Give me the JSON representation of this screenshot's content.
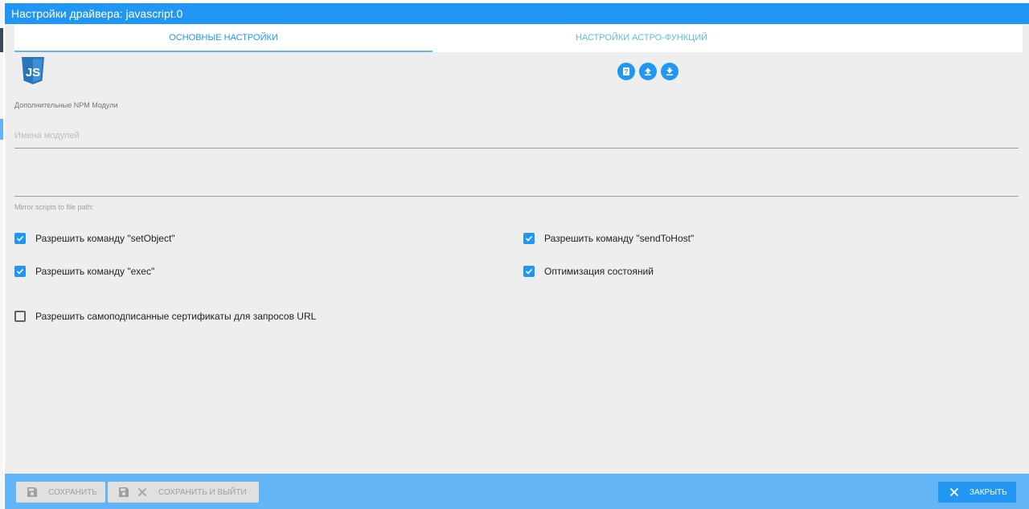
{
  "dialog": {
    "title": "Настройки драйвера: javascript.0"
  },
  "tabs": [
    {
      "label": "ОСНОВНЫЕ НАСТРОЙКИ",
      "active": true
    },
    {
      "label": "НАСТРОЙКИ АСТРО-ФУНКЦИЙ",
      "active": false
    }
  ],
  "logo": {
    "icon": "javascript-logo-icon",
    "color": "#2a74b9"
  },
  "actions": [
    {
      "icon": "help-book-icon"
    },
    {
      "icon": "upload-icon"
    },
    {
      "icon": "download-icon"
    }
  ],
  "npm": {
    "label": "Дополнительные NPM Модули",
    "placeholder": "Имена модулей",
    "value": ""
  },
  "mirror": {
    "label": "Mirror scripts to file path:"
  },
  "checkboxes": {
    "set_object": {
      "label": "Разрешить команду \"setObject\"",
      "checked": true
    },
    "send_to_host": {
      "label": "Разрешить команду \"sendToHost\"",
      "checked": true
    },
    "exec": {
      "label": "Разрешить команду \"exec\"",
      "checked": true
    },
    "optimize_states": {
      "label": "Оптимизация состояний",
      "checked": true
    },
    "self_signed": {
      "label": "Разрешить самоподписанные сертификаты для запросов URL",
      "checked": false
    }
  },
  "footer": {
    "save_label": "СОХРАНИТЬ",
    "save_close_label": "СОХРАНИТЬ И ВЫЙТИ",
    "close_label": "ЗАКРЫТЬ"
  },
  "colors": {
    "primary": "#2196f3",
    "footer": "#64b5f6",
    "background": "#eeeeee"
  }
}
